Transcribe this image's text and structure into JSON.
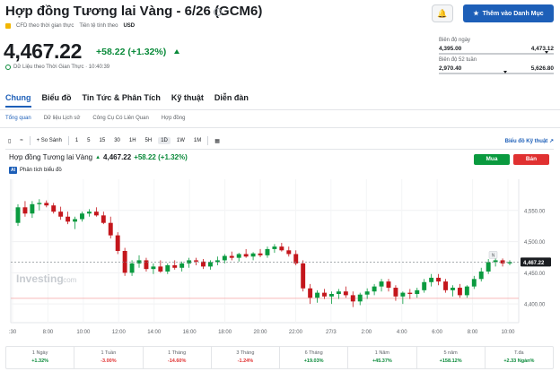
{
  "header": {
    "title": "Hợp đồng Tương lai Vàng - 6/26 (GCM6)",
    "cfd_label": "CFD theo thời gian thực",
    "currency_label": "Tiền tệ tính theo",
    "currency": "USD",
    "price": "4,467.22",
    "change": "+58.22 (+1.32%)",
    "data_time_label": "Dữ Liệu theo Thời Gian Thực · 10:40:39",
    "watchlist_button": "Thêm vào Danh Mục"
  },
  "ranges": {
    "day_label": "Biên độ ngày",
    "day_low": "4,395.00",
    "day_high": "4,473.12",
    "day_pos": 0.92,
    "week52_label": "Biên độ 52 tuần",
    "week52_low": "2,970.40",
    "week52_high": "5,626.80",
    "week52_pos": 0.56
  },
  "tabs": [
    "Chung",
    "Biểu đồ",
    "Tin Tức & Phân Tích",
    "Kỹ thuật",
    "Diễn đàn"
  ],
  "subtabs": [
    "Tổng quan",
    "Dữ liệu Lịch sử",
    "Công Cụ Có Liên Quan",
    "Hợp đồng"
  ],
  "toolbar": {
    "compare": "So Sánh",
    "intervals": [
      "1",
      "5",
      "15",
      "30",
      "1H",
      "5H",
      "1D",
      "1W",
      "1M"
    ],
    "selected_interval": "1D",
    "chart_link": "Biểu đồ Kỹ thuật"
  },
  "chart_header": {
    "name": "Hợp đồng Tương lai Vàng",
    "price": "4,467.22",
    "change": "+58.22 (+1.32%)",
    "analysis": "Phân tích biểu đồ",
    "ai_badge": "AI",
    "buy": "Mua",
    "sell": "Bán",
    "watermark": "Investing",
    "watermark_suffix": ".com",
    "marker_label": "N"
  },
  "chart_data": {
    "type": "candlestick",
    "ylim": [
      4370,
      4600
    ],
    "y_ticks": [
      4400,
      4450,
      4500,
      4550
    ],
    "y_tick_labels": [
      "4,400.00",
      "4,450.00",
      "4,500.00",
      "4,550.00"
    ],
    "x_tick_labels": [
      ":30",
      "8:00",
      "10:00",
      "12:00",
      "14:00",
      "16:00",
      "18:00",
      "20:00",
      "22:00",
      "27/3",
      "2:00",
      "4:00",
      "6:00",
      "8:00",
      "10:00"
    ],
    "current_price": 4467.22,
    "current_price_label": "4,467.22",
    "previous_close": 4409,
    "candles": [
      [
        4530,
        4560,
        4525,
        4555
      ],
      [
        4555,
        4565,
        4540,
        4545
      ],
      [
        4545,
        4565,
        4538,
        4560
      ],
      [
        4560,
        4568,
        4550,
        4562
      ],
      [
        4562,
        4566,
        4555,
        4558
      ],
      [
        4558,
        4562,
        4545,
        4548
      ],
      [
        4548,
        4556,
        4535,
        4540
      ],
      [
        4540,
        4548,
        4528,
        4532
      ],
      [
        4532,
        4540,
        4520,
        4536
      ],
      [
        4536,
        4548,
        4532,
        4545
      ],
      [
        4545,
        4552,
        4540,
        4548
      ],
      [
        4548,
        4555,
        4540,
        4542
      ],
      [
        4542,
        4548,
        4528,
        4530
      ],
      [
        4530,
        4540,
        4505,
        4510
      ],
      [
        4510,
        4515,
        4480,
        4485
      ],
      [
        4485,
        4490,
        4445,
        4450
      ],
      [
        4450,
        4470,
        4445,
        4465
      ],
      [
        4465,
        4478,
        4458,
        4470
      ],
      [
        4470,
        4474,
        4452,
        4456
      ],
      [
        4456,
        4465,
        4448,
        4460
      ],
      [
        4460,
        4470,
        4450,
        4452
      ],
      [
        4452,
        4465,
        4448,
        4462
      ],
      [
        4462,
        4470,
        4455,
        4458
      ],
      [
        4458,
        4468,
        4452,
        4465
      ],
      [
        4465,
        4474,
        4458,
        4470
      ],
      [
        4470,
        4474,
        4462,
        4468
      ],
      [
        4468,
        4472,
        4456,
        4460
      ],
      [
        4460,
        4470,
        4455,
        4467
      ],
      [
        4467,
        4476,
        4462,
        4470
      ],
      [
        4470,
        4480,
        4465,
        4477
      ],
      [
        4477,
        4484,
        4470,
        4474
      ],
      [
        4474,
        4482,
        4468,
        4480
      ],
      [
        4480,
        4488,
        4474,
        4476
      ],
      [
        4476,
        4483,
        4470,
        4481
      ],
      [
        4481,
        4488,
        4475,
        4478
      ],
      [
        4478,
        4492,
        4474,
        4488
      ],
      [
        4488,
        4496,
        4482,
        4492
      ],
      [
        4492,
        4498,
        4484,
        4486
      ],
      [
        4486,
        4492,
        4476,
        4480
      ],
      [
        4480,
        4486,
        4462,
        4465
      ],
      [
        4465,
        4470,
        4420,
        4425
      ],
      [
        4425,
        4432,
        4400,
        4410
      ],
      [
        4410,
        4422,
        4402,
        4418
      ],
      [
        4418,
        4424,
        4408,
        4412
      ],
      [
        4412,
        4420,
        4400,
        4416
      ],
      [
        4416,
        4424,
        4408,
        4420
      ],
      [
        4420,
        4428,
        4410,
        4414
      ],
      [
        4414,
        4420,
        4395,
        4404
      ],
      [
        4404,
        4418,
        4398,
        4415
      ],
      [
        4415,
        4425,
        4408,
        4420
      ],
      [
        4420,
        4432,
        4414,
        4428
      ],
      [
        4428,
        4440,
        4420,
        4436
      ],
      [
        4436,
        4440,
        4420,
        4426
      ],
      [
        4426,
        4430,
        4405,
        4412
      ],
      [
        4412,
        4420,
        4400,
        4418
      ],
      [
        4418,
        4424,
        4408,
        4416
      ],
      [
        4416,
        4426,
        4410,
        4422
      ],
      [
        4422,
        4440,
        4418,
        4435
      ],
      [
        4435,
        4448,
        4428,
        4442
      ],
      [
        4442,
        4448,
        4430,
        4436
      ],
      [
        4436,
        4440,
        4418,
        4422
      ],
      [
        4422,
        4430,
        4412,
        4426
      ],
      [
        4426,
        4432,
        4410,
        4414
      ],
      [
        4414,
        4430,
        4410,
        4428
      ],
      [
        4428,
        4445,
        4424,
        4440
      ],
      [
        4440,
        4458,
        4436,
        4452
      ],
      [
        4452,
        4472,
        4448,
        4467
      ],
      [
        4467,
        4474,
        4460,
        4470
      ],
      [
        4470,
        4473,
        4460,
        4465
      ],
      [
        4465,
        4470,
        4462,
        4467
      ]
    ]
  },
  "performance": [
    {
      "label": "1 Ngày",
      "value": "+1.32%",
      "dir": "pos"
    },
    {
      "label": "1 Tuần",
      "value": "-3.00%",
      "dir": "neg"
    },
    {
      "label": "1 Tháng",
      "value": "-14.60%",
      "dir": "neg"
    },
    {
      "label": "3 Tháng",
      "value": "-1.24%",
      "dir": "neg"
    },
    {
      "label": "6 Tháng",
      "value": "+19.03%",
      "dir": "pos"
    },
    {
      "label": "1 Năm",
      "value": "+45.37%",
      "dir": "pos"
    },
    {
      "label": "5 năm",
      "value": "+158.12%",
      "dir": "pos"
    },
    {
      "label": "T.đa",
      "value": "+2.33 Ngàn%",
      "dir": "pos"
    }
  ],
  "colors": {
    "up": "#0a9a3f",
    "down": "#c4161c",
    "accent": "#1d5fb8"
  }
}
